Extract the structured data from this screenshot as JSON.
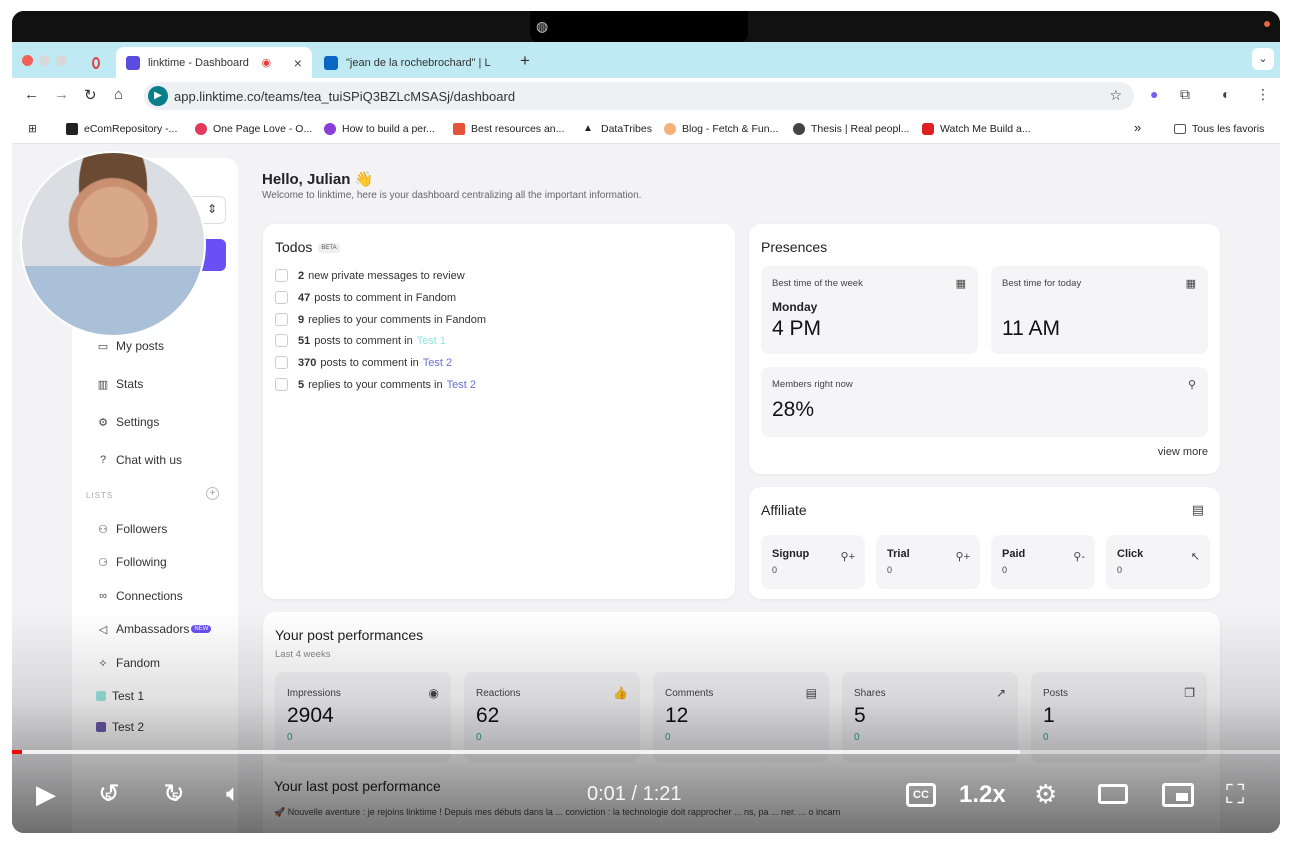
{
  "browser": {
    "tabs": [
      {
        "label": "linktime - Dashboard",
        "active": true
      },
      {
        "label": "\"jean de la rochebrochard\" | L",
        "active": false
      }
    ],
    "new_tab": "+",
    "url": "app.linktime.co/teams/tea_tuiSPiQ3BZLcMSASj/dashboard",
    "bookmarks": [
      "eComRepository -...",
      "One Page Love - O...",
      "How to build a per...",
      "Best resources an...",
      "DataTribes",
      "Blog - Fetch & Fun...",
      "Thesis | Real peopl...",
      "Watch Me Build a..."
    ],
    "bookmarks_more": "»",
    "all_bookmarks": "Tous les favoris"
  },
  "sidebar": {
    "items": [
      {
        "label": "My posts",
        "icon": "posts-icon"
      },
      {
        "label": "Stats",
        "icon": "bar-chart-icon"
      },
      {
        "label": "Settings",
        "icon": "gear-icon"
      },
      {
        "label": "Chat with us",
        "icon": "help-icon"
      }
    ],
    "lists_label": "LISTS",
    "lists": [
      {
        "label": "Followers",
        "icon": "users-icon"
      },
      {
        "label": "Following",
        "icon": "user-follow-icon"
      },
      {
        "label": "Connections",
        "icon": "link-icon"
      },
      {
        "label": "Ambassadors",
        "icon": "megaphone-icon",
        "badge": "NEW"
      },
      {
        "label": "Fandom",
        "icon": "sparkle-icon"
      },
      {
        "label": "Test 1",
        "color": "#9ee7e3"
      },
      {
        "label": "Test 2",
        "color": "#6f5ab0"
      }
    ]
  },
  "header": {
    "greeting": "Hello, Julian 👋",
    "subtitle": "Welcome to linktime, here is your dashboard centralizing all the important information."
  },
  "todos": {
    "title": "Todos",
    "badge": "BETA",
    "items": [
      {
        "count": "2",
        "text": "new private messages to review",
        "link": ""
      },
      {
        "count": "47",
        "text": "posts to comment in Fandom",
        "link": ""
      },
      {
        "count": "9",
        "text": "replies to your comments in Fandom",
        "link": ""
      },
      {
        "count": "51",
        "text": "posts to comment in",
        "link": "Test 1"
      },
      {
        "count": "370",
        "text": "posts to comment in",
        "link": "Test 2"
      },
      {
        "count": "5",
        "text": "replies to your comments in",
        "link": "Test 2"
      }
    ]
  },
  "presences": {
    "title": "Presences",
    "best_week": {
      "label": "Best time of the week",
      "day": "Monday",
      "time": "4 PM"
    },
    "best_today": {
      "label": "Best time for today",
      "time": "11 AM"
    },
    "members_now": {
      "label": "Members right now",
      "value": "28%"
    },
    "view_more": "view more"
  },
  "affiliate": {
    "title": "Affiliate",
    "items": [
      {
        "label": "Signup",
        "value": "0"
      },
      {
        "label": "Trial",
        "value": "0"
      },
      {
        "label": "Paid",
        "value": "0"
      },
      {
        "label": "Click",
        "value": "0"
      }
    ]
  },
  "performance": {
    "title": "Your post performances",
    "subtitle": "Last 4 weeks",
    "items": [
      {
        "label": "Impressions",
        "value": "2904",
        "delta": "0",
        "icon": "eye-icon"
      },
      {
        "label": "Reactions",
        "value": "62",
        "delta": "0",
        "icon": "thumbs-up-icon"
      },
      {
        "label": "Comments",
        "value": "12",
        "delta": "0",
        "icon": "comment-icon"
      },
      {
        "label": "Shares",
        "value": "5",
        "delta": "0",
        "icon": "share-icon"
      },
      {
        "label": "Posts",
        "value": "1",
        "delta": "0",
        "icon": "posts-icon"
      }
    ]
  },
  "last_post": {
    "title": "Your last post performance",
    "text": "🚀 Nouvelle aventure : je rejoins linktime ! Depuis mes débuts dans la ... conviction : la technologie doit rapprocher ... ns, pa ... ner. ... o incarn"
  },
  "player": {
    "timecode": "0:01 / 1:21",
    "speed": "1.2x",
    "cc": "CC",
    "skip_back": "5",
    "skip_fwd": "5",
    "progress": 0.008,
    "buffered": 0.795
  }
}
